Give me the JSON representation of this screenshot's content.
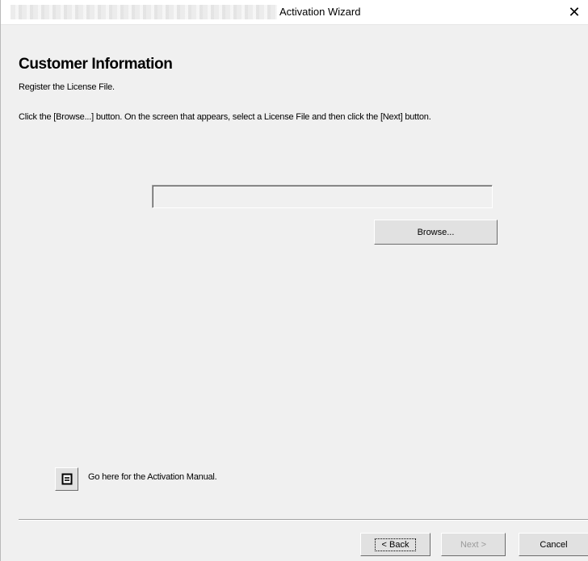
{
  "window": {
    "title": "Activation Wizard",
    "close_glyph": "✕"
  },
  "page": {
    "title": "Customer Information",
    "subtitle": "Register the License File.",
    "instructions": "Click the [Browse...] button. On the screen that appears, select a License File and then click the [Next] button."
  },
  "license_file": {
    "value": ""
  },
  "buttons": {
    "browse": "Browse...",
    "back": "< Back",
    "next": "Next >",
    "cancel": "Cancel"
  },
  "manual": {
    "icon": "document-icon",
    "text": "Go here for the Activation Manual."
  }
}
